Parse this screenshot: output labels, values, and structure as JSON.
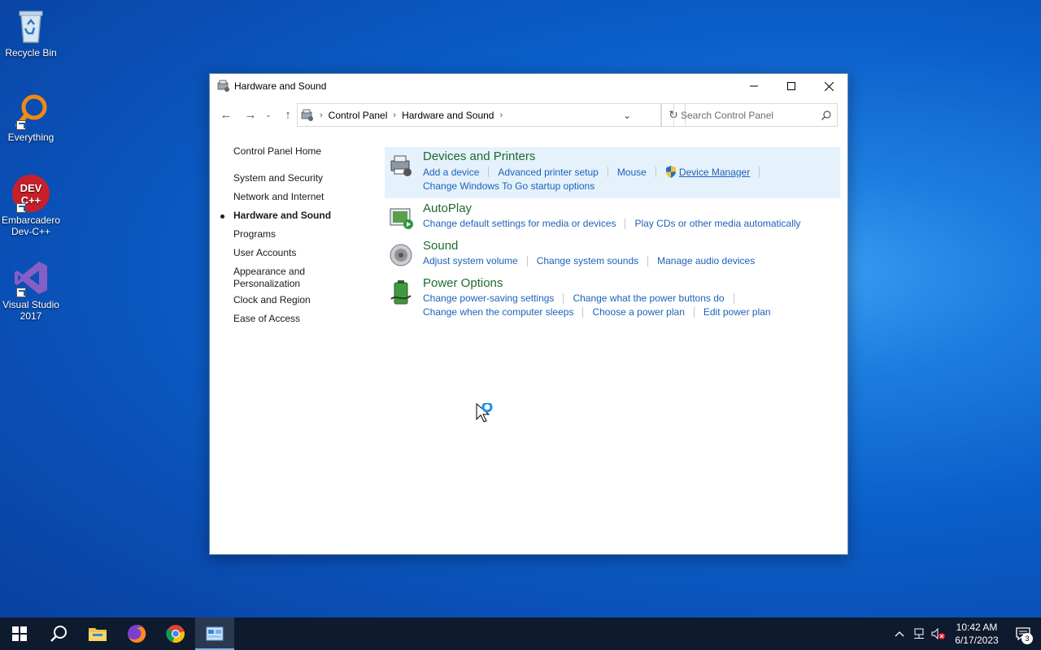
{
  "desktop": {
    "icons": [
      {
        "label": "Recycle Bin"
      },
      {
        "label": "Everything"
      },
      {
        "label": "Embarcadero Dev-C++"
      },
      {
        "label": "Visual Studio 2017"
      }
    ]
  },
  "window": {
    "title": "Hardware and Sound",
    "breadcrumb": [
      "Control Panel",
      "Hardware and Sound"
    ],
    "search_placeholder": "Search Control Panel"
  },
  "leftnav": {
    "items": [
      {
        "label": "Control Panel Home"
      },
      {
        "label": "System and Security"
      },
      {
        "label": "Network and Internet"
      },
      {
        "label": "Hardware and Sound"
      },
      {
        "label": "Programs"
      },
      {
        "label": "User Accounts"
      },
      {
        "label": "Appearance and Personalization"
      },
      {
        "label": "Clock and Region"
      },
      {
        "label": "Ease of Access"
      }
    ]
  },
  "categories": {
    "devices": {
      "title": "Devices and Printers",
      "links": [
        "Add a device",
        "Advanced printer setup",
        "Mouse",
        "Device Manager",
        "Change Windows To Go startup options"
      ]
    },
    "autoplay": {
      "title": "AutoPlay",
      "links": [
        "Change default settings for media or devices",
        "Play CDs or other media automatically"
      ]
    },
    "sound": {
      "title": "Sound",
      "links": [
        "Adjust system volume",
        "Change system sounds",
        "Manage audio devices"
      ]
    },
    "power": {
      "title": "Power Options",
      "links": [
        "Change power-saving settings",
        "Change what the power buttons do",
        "Change when the computer sleeps",
        "Choose a power plan",
        "Edit power plan"
      ]
    }
  },
  "taskbar": {
    "time": "10:42 AM",
    "date": "6/17/2023",
    "notification_count": "3"
  },
  "colors": {
    "category_title": "#1e6b2e",
    "link": "#1c62b9",
    "highlight": "#e5f1fb",
    "taskbar": "#0e1a2e"
  }
}
